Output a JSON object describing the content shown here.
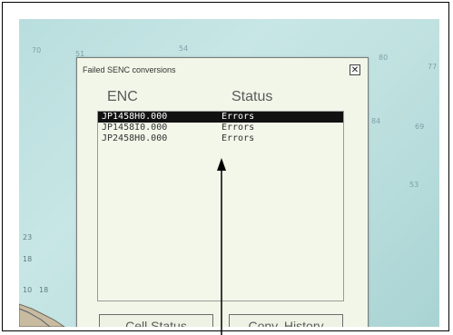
{
  "dialog": {
    "title": "Failed SENC conversions",
    "close_icon": "close-icon",
    "column_enc": "ENC",
    "column_status": "Status",
    "rows": [
      {
        "enc": "JP1458H0.000",
        "status": "Errors",
        "selected": true
      },
      {
        "enc": "JP1458I0.000",
        "status": "Errors",
        "selected": false
      },
      {
        "enc": "JP2458H0.000",
        "status": "Errors",
        "selected": false
      }
    ],
    "buttons": {
      "cell_status": "Cell Status",
      "conv_history": "Conv. History"
    }
  },
  "chart_background": {
    "depths": [
      "70",
      "51",
      "54",
      "80",
      "77",
      "84",
      "69",
      "53",
      "23",
      "18",
      "10",
      "18"
    ]
  },
  "colors": {
    "chart_water": "#c7e6e5",
    "dialog_bg": "#f2f6e8",
    "selected_row": "#111111"
  }
}
